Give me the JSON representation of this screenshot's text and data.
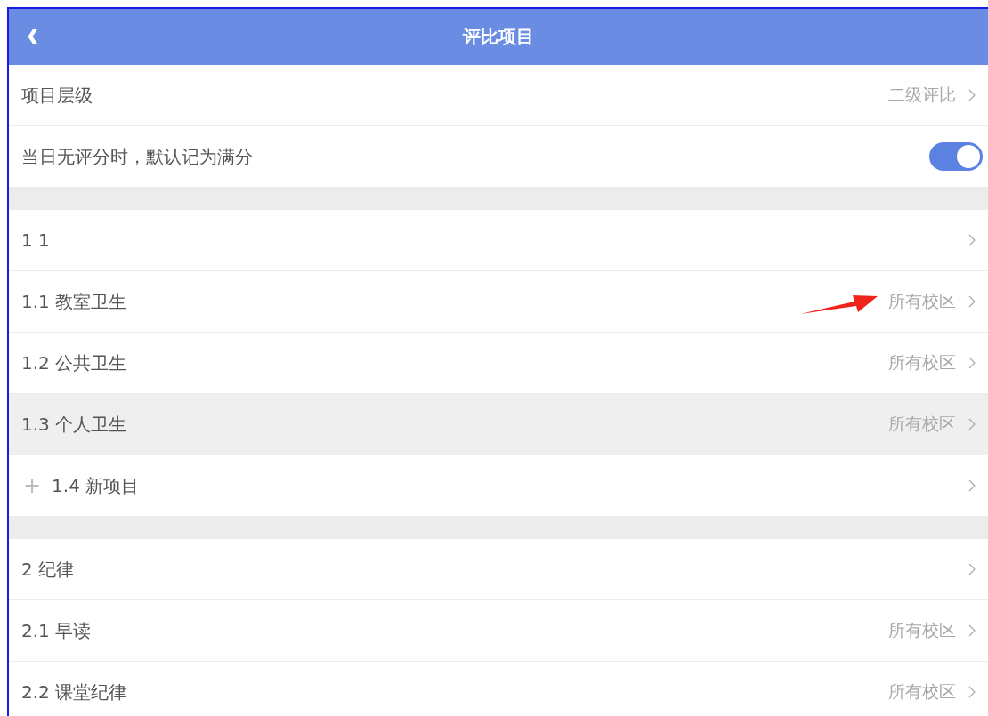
{
  "header": {
    "back_icon": "‹",
    "title": "评比项目"
  },
  "settings": [
    {
      "kind": "value",
      "label": "项目层级",
      "value": "二级评比"
    },
    {
      "kind": "toggle",
      "label": "当日无评分时，默认记为满分",
      "on": true
    }
  ],
  "groups": [
    {
      "rows": [
        {
          "kind": "item",
          "label": "1 1",
          "highlighted": false
        },
        {
          "kind": "item",
          "label": "1.1 教室卫生",
          "value": "所有校区",
          "highlighted": false,
          "annotated": true
        },
        {
          "kind": "item",
          "label": "1.2 公共卫生",
          "value": "所有校区",
          "highlighted": false
        },
        {
          "kind": "item",
          "label": "1.3 个人卫生",
          "value": "所有校区",
          "highlighted": true
        },
        {
          "kind": "add",
          "icon": "+",
          "label": "1.4 新项目",
          "highlighted": false
        }
      ]
    },
    {
      "rows": [
        {
          "kind": "item",
          "label": "2 纪律",
          "highlighted": false
        },
        {
          "kind": "item",
          "label": "2.1 早读",
          "value": "所有校区",
          "highlighted": false
        },
        {
          "kind": "item",
          "label": "2.2 课堂纪律",
          "value": "所有校区",
          "highlighted": false
        }
      ]
    }
  ]
}
